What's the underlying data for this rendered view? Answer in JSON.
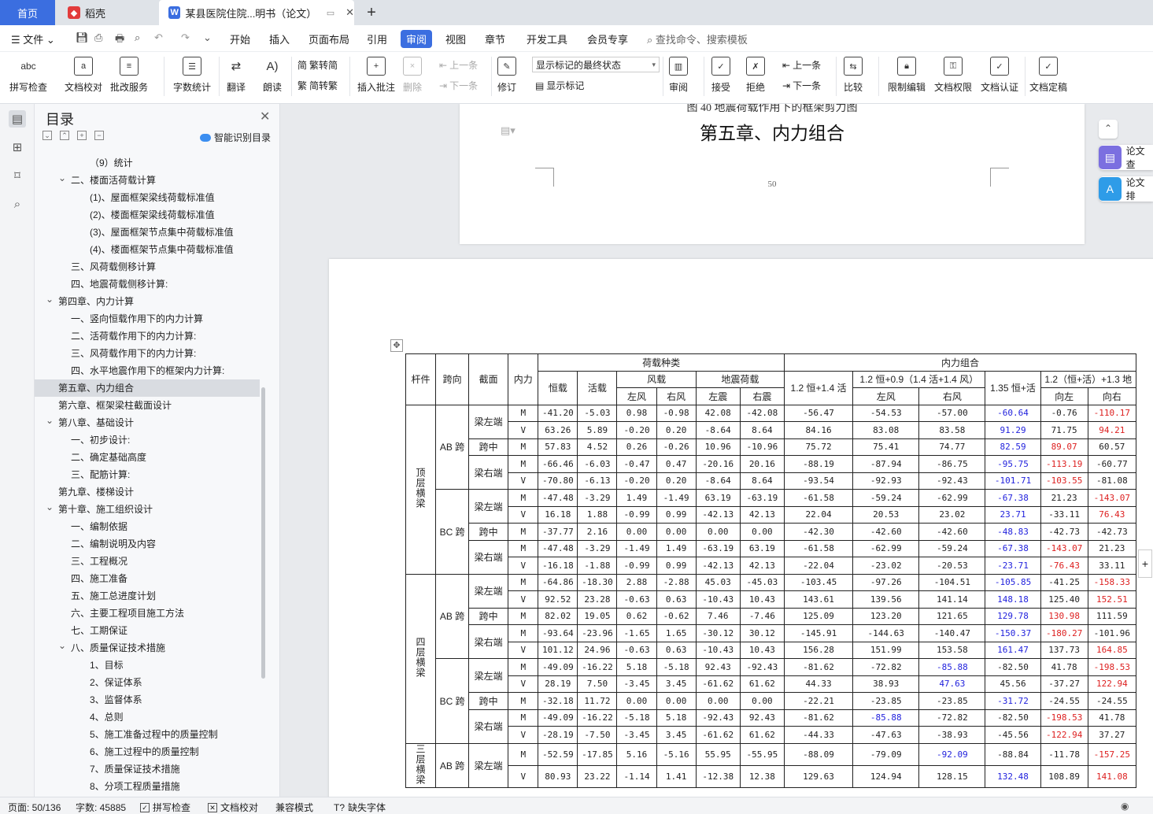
{
  "tabs": {
    "home": "首页",
    "daoke": "稻壳",
    "doc": "某县医院住院...明书（论文）",
    "plus": "+"
  },
  "menu": {
    "file": "文件",
    "items": [
      "开始",
      "插入",
      "页面布局",
      "引用",
      "审阅",
      "视图",
      "章节",
      "开发工具",
      "会员专享"
    ],
    "search": "查找命令、搜索模板"
  },
  "ribbon": {
    "spell": "拼写检查",
    "proof": "文档校对",
    "batch": "批改服务",
    "wordcount": "字数统计",
    "translate": "翻译",
    "read": "朗读",
    "trad2simp": "繁转简",
    "simp2trad": "简转繁",
    "insert_comment": "插入批注",
    "delete": "删除",
    "prev": "上一条",
    "next": "下一条",
    "revise": "修订",
    "markup_state": "显示标记的最终状态",
    "show_markup": "显示标记",
    "review": "审阅",
    "accept": "接受",
    "reject": "拒绝",
    "prev2": "上一条",
    "next2": "下一条",
    "compare": "比较",
    "restrict": "限制编辑",
    "permission": "文档权限",
    "certify": "文档认证",
    "finalize": "文档定稿"
  },
  "toc": {
    "title": "目录",
    "smart": "智能识别目录",
    "items": [
      {
        "text": "（9）统计",
        "level": 3
      },
      {
        "text": "二、楼面活荷载计算",
        "level": 2,
        "caret": true
      },
      {
        "text": "(1)、屋面框架梁线荷载标准值",
        "level": 3
      },
      {
        "text": "(2)、楼面框架梁线荷载标准值",
        "level": 3
      },
      {
        "text": "(3)、屋面框架节点集中荷载标准值",
        "level": 3
      },
      {
        "text": "(4)、楼面框架节点集中荷载标准值",
        "level": 3
      },
      {
        "text": "三、风荷载侧移计算",
        "level": 2
      },
      {
        "text": "四、地震荷载侧移计算:",
        "level": 2
      },
      {
        "text": "第四章、内力计算",
        "level": 1,
        "caret": true
      },
      {
        "text": "一、竖向恒载作用下的内力计算",
        "level": 2
      },
      {
        "text": "二、活荷载作用下的内力计算:",
        "level": 2
      },
      {
        "text": "三、风荷载作用下的内力计算:",
        "level": 2
      },
      {
        "text": "四、水平地震作用下的框架内力计算:",
        "level": 2
      },
      {
        "text": "第五章、内力组合",
        "level": 1,
        "selected": true
      },
      {
        "text": "第六章、框架梁柱截面设计",
        "level": 1
      },
      {
        "text": "第八章、基础设计",
        "level": 1,
        "caret": true
      },
      {
        "text": "一、初步设计:",
        "level": 2
      },
      {
        "text": "二、确定基础高度",
        "level": 2
      },
      {
        "text": "三、配筋计算:",
        "level": 2
      },
      {
        "text": "第九章、楼梯设计",
        "level": 1
      },
      {
        "text": "第十章、施工组织设计",
        "level": 1,
        "caret": true
      },
      {
        "text": "一、编制依据",
        "level": 2
      },
      {
        "text": "二、编制说明及内容",
        "level": 2
      },
      {
        "text": "三、工程概况",
        "level": 2
      },
      {
        "text": "四、施工准备",
        "level": 2
      },
      {
        "text": "五、施工总进度计划",
        "level": 2
      },
      {
        "text": "六、主要工程项目施工方法",
        "level": 2
      },
      {
        "text": "七、工期保证",
        "level": 2
      },
      {
        "text": "八、质量保证技术措施",
        "level": 2,
        "caret": true
      },
      {
        "text": "1、目标",
        "level": 3
      },
      {
        "text": "2、保证体系",
        "level": 3
      },
      {
        "text": "3、监督体系",
        "level": 3
      },
      {
        "text": "4、总则",
        "level": 3
      },
      {
        "text": "5、施工准备过程中的质量控制",
        "level": 3
      },
      {
        "text": "6、施工过程中的质量控制",
        "level": 3
      },
      {
        "text": "7、质量保证技术措施",
        "level": 3
      },
      {
        "text": "8、分项工程质量措施",
        "level": 3
      }
    ]
  },
  "page1": {
    "caption": "图 40 地震荷载作用下的框架剪力图",
    "chapter": "第五章、内力组合",
    "page_number": "50"
  },
  "table": {
    "h": {
      "member": "杆件",
      "span": "跨向",
      "section": "截面",
      "force": "内力",
      "load_types": "荷载种类",
      "combination": "内力组合",
      "dead": "恒载",
      "live": "活载",
      "wind": "风载",
      "quake": "地震荷载",
      "left_wind": "左风",
      "right_wind": "右风",
      "left_quake": "左震",
      "right_quake": "右震",
      "c1": "1.2 恒+1.4 活",
      "c2": "1.2 恒+0.9（1.4 活+1.4 风）",
      "c3": "1.35 恒+活",
      "c4": "1.2（恒+活）+1.3 地",
      "left": "左风",
      "right": "右风",
      "toleft": "向左",
      "toright": "向右"
    },
    "groups": [
      {
        "member": "顶层横梁",
        "spans": [
          {
            "span": "AB 跨",
            "rows": [
              {
                "sec": "梁左端",
                "f": "M",
                "v": [
                  "-41.20",
                  "-5.03",
                  "0.98",
                  "-0.98",
                  "42.08",
                  "-42.08",
                  "-56.47",
                  "-54.53",
                  "-57.00",
                  "-60.64",
                  "-0.76",
                  "-110.17"
                ]
              },
              {
                "f": "V",
                "v": [
                  "63.26",
                  "5.89",
                  "-0.20",
                  "0.20",
                  "-8.64",
                  "8.64",
                  "84.16",
                  "83.08",
                  "83.58",
                  "91.29",
                  "71.75",
                  "94.21"
                ]
              },
              {
                "sec": "跨中",
                "f": "M",
                "v": [
                  "57.83",
                  "4.52",
                  "0.26",
                  "-0.26",
                  "10.96",
                  "-10.96",
                  "75.72",
                  "75.41",
                  "74.77",
                  "82.59",
                  "89.07",
                  "60.57"
                ]
              },
              {
                "sec": "梁右端",
                "f": "M",
                "v": [
                  "-66.46",
                  "-6.03",
                  "-0.47",
                  "0.47",
                  "-20.16",
                  "20.16",
                  "-88.19",
                  "-87.94",
                  "-86.75",
                  "-95.75",
                  "-113.19",
                  "-60.77"
                ]
              },
              {
                "f": "V",
                "v": [
                  "-70.80",
                  "-6.13",
                  "-0.20",
                  "0.20",
                  "-8.64",
                  "8.64",
                  "-93.54",
                  "-92.93",
                  "-92.43",
                  "-101.71",
                  "-103.55",
                  "-81.08"
                ]
              }
            ]
          },
          {
            "span": "BC 跨",
            "rows": [
              {
                "sec": "梁左端",
                "f": "M",
                "v": [
                  "-47.48",
                  "-3.29",
                  "1.49",
                  "-1.49",
                  "63.19",
                  "-63.19",
                  "-61.58",
                  "-59.24",
                  "-62.99",
                  "-67.38",
                  "21.23",
                  "-143.07"
                ]
              },
              {
                "f": "V",
                "v": [
                  "16.18",
                  "1.88",
                  "-0.99",
                  "0.99",
                  "-42.13",
                  "42.13",
                  "22.04",
                  "20.53",
                  "23.02",
                  "23.71",
                  "-33.11",
                  "76.43"
                ]
              },
              {
                "sec": "跨中",
                "f": "M",
                "v": [
                  "-37.77",
                  "2.16",
                  "0.00",
                  "0.00",
                  "0.00",
                  "0.00",
                  "-42.30",
                  "-42.60",
                  "-42.60",
                  "-48.83",
                  "-42.73",
                  "-42.73"
                ]
              },
              {
                "sec": "梁右端",
                "f": "M",
                "v": [
                  "-47.48",
                  "-3.29",
                  "-1.49",
                  "1.49",
                  "-63.19",
                  "63.19",
                  "-61.58",
                  "-62.99",
                  "-59.24",
                  "-67.38",
                  "-143.07",
                  "21.23"
                ]
              },
              {
                "f": "V",
                "v": [
                  "-16.18",
                  "-1.88",
                  "-0.99",
                  "0.99",
                  "-42.13",
                  "42.13",
                  "-22.04",
                  "-23.02",
                  "-20.53",
                  "-23.71",
                  "-76.43",
                  "33.11"
                ]
              }
            ]
          }
        ]
      },
      {
        "member": "四层横梁",
        "spans": [
          {
            "span": "AB 跨",
            "rows": [
              {
                "sec": "梁左端",
                "f": "M",
                "v": [
                  "-64.86",
                  "-18.30",
                  "2.88",
                  "-2.88",
                  "45.03",
                  "-45.03",
                  "-103.45",
                  "-97.26",
                  "-104.51",
                  "-105.85",
                  "-41.25",
                  "-158.33"
                ]
              },
              {
                "f": "V",
                "v": [
                  "92.52",
                  "23.28",
                  "-0.63",
                  "0.63",
                  "-10.43",
                  "10.43",
                  "143.61",
                  "139.56",
                  "141.14",
                  "148.18",
                  "125.40",
                  "152.51"
                ]
              },
              {
                "sec": "跨中",
                "f": "M",
                "v": [
                  "82.02",
                  "19.05",
                  "0.62",
                  "-0.62",
                  "7.46",
                  "-7.46",
                  "125.09",
                  "123.20",
                  "121.65",
                  "129.78",
                  "130.98",
                  "111.59"
                ]
              },
              {
                "sec": "梁右端",
                "f": "M",
                "v": [
                  "-93.64",
                  "-23.96",
                  "-1.65",
                  "1.65",
                  "-30.12",
                  "30.12",
                  "-145.91",
                  "-144.63",
                  "-140.47",
                  "-150.37",
                  "-180.27",
                  "-101.96"
                ]
              },
              {
                "f": "V",
                "v": [
                  "101.12",
                  "24.96",
                  "-0.63",
                  "0.63",
                  "-10.43",
                  "10.43",
                  "156.28",
                  "151.99",
                  "153.58",
                  "161.47",
                  "137.73",
                  "164.85"
                ]
              }
            ]
          },
          {
            "span": "BC 跨",
            "rows": [
              {
                "sec": "梁左端",
                "f": "M",
                "v": [
                  "-49.09",
                  "-16.22",
                  "5.18",
                  "-5.18",
                  "92.43",
                  "-92.43",
                  "-81.62",
                  "-72.82",
                  "-85.88",
                  "-82.50",
                  "41.78",
                  "-198.53"
                ]
              },
              {
                "f": "V",
                "v": [
                  "28.19",
                  "7.50",
                  "-3.45",
                  "3.45",
                  "-61.62",
                  "61.62",
                  "44.33",
                  "38.93",
                  "47.63",
                  "45.56",
                  "-37.27",
                  "122.94"
                ]
              },
              {
                "sec": "跨中",
                "f": "M",
                "v": [
                  "-32.18",
                  "11.72",
                  "0.00",
                  "0.00",
                  "0.00",
                  "0.00",
                  "-22.21",
                  "-23.85",
                  "-23.85",
                  "-31.72",
                  "-24.55",
                  "-24.55"
                ]
              },
              {
                "sec": "梁右端",
                "f": "M",
                "v": [
                  "-49.09",
                  "-16.22",
                  "-5.18",
                  "5.18",
                  "-92.43",
                  "92.43",
                  "-81.62",
                  "-85.88",
                  "-72.82",
                  "-82.50",
                  "-198.53",
                  "41.78"
                ]
              },
              {
                "f": "V",
                "v": [
                  "-28.19",
                  "-7.50",
                  "-3.45",
                  "3.45",
                  "-61.62",
                  "61.62",
                  "-44.33",
                  "-47.63",
                  "-38.93",
                  "-45.56",
                  "-122.94",
                  "37.27"
                ]
              }
            ]
          }
        ]
      },
      {
        "member": "三层横梁",
        "spans": [
          {
            "span": "AB 跨",
            "rows": [
              {
                "sec": "梁左端",
                "f": "M",
                "v": [
                  "-52.59",
                  "-17.85",
                  "5.16",
                  "-5.16",
                  "55.95",
                  "-55.95",
                  "-88.09",
                  "-79.09",
                  "-92.09",
                  "-88.84",
                  "-11.78",
                  "-157.25"
                ]
              },
              {
                "f": "V",
                "v": [
                  "80.93",
                  "23.22",
                  "-1.14",
                  "1.41",
                  "-12.38",
                  "12.38",
                  "129.63",
                  "124.94",
                  "128.15",
                  "132.48",
                  "108.89",
                  "141.08"
                ]
              }
            ]
          }
        ]
      }
    ]
  },
  "rightpanel": {
    "b1": "论文查",
    "b2": "论文排"
  },
  "status": {
    "page": "页面: 50/136",
    "words": "字数: 45885",
    "spell": "拼写检查",
    "proof": "文档校对",
    "compat": "兼容模式",
    "font": "缺失字体"
  },
  "colors": {
    "accent": "#3b6ee0",
    "blue_value": "#2222dd",
    "red_value": "#dd2020"
  }
}
